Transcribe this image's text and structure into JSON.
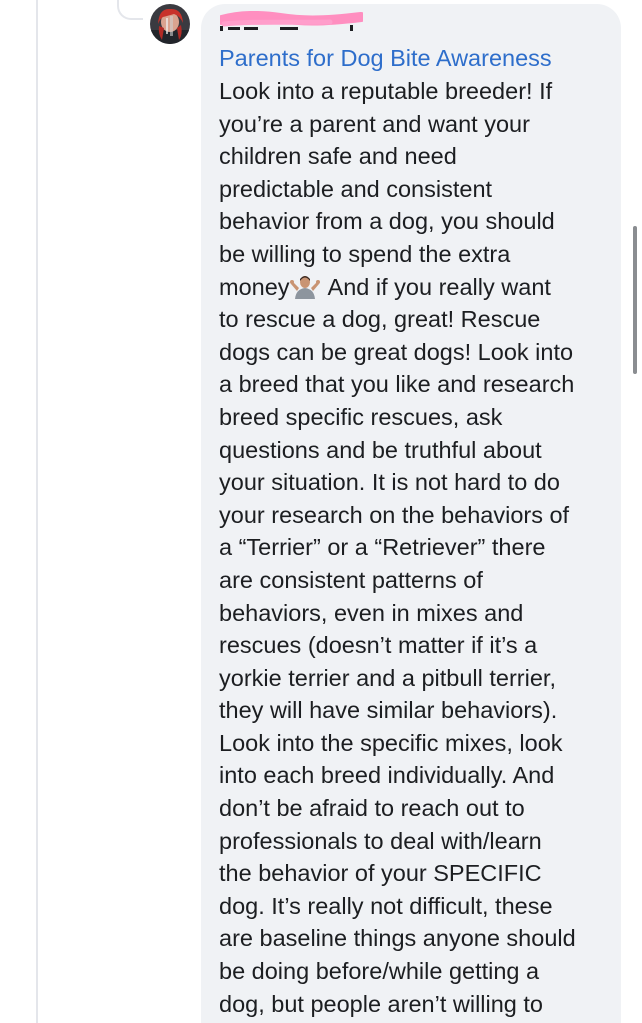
{
  "comment": {
    "group_link": "Parents for Dog Bite Awareness",
    "lines_before_emoji": [
      "Look into a reputable breeder! If",
      "you’re a parent and want your",
      "children safe and need",
      "predictable and consistent",
      "behavior from a dog, you should",
      "be willing to spend the extra"
    ],
    "emoji_line_start": "money",
    "emoji_line_end": "And if you really want",
    "lines_after_emoji": [
      "to rescue a dog, great! Rescue",
      "dogs can be great dogs! Look into",
      "a breed that you like and research",
      "breed specific rescues, ask",
      "questions and be truthful about",
      "your situation. It is not hard to do",
      "your research on the behaviors of",
      "a “Terrier” or a “Retriever” there",
      "are consistent patterns of",
      "behaviors, even in mixes and",
      "rescues (doesn’t matter if it’s a",
      "yorkie terrier and a pitbull terrier,",
      "they will have similar behaviors).",
      "Look into the specific mixes, look",
      "into each breed individually. And",
      "don’t be afraid to reach out to",
      "professionals to deal with/learn",
      "the behavior of your SPECIFIC",
      "dog. It’s really not difficult, these",
      "are baseline things anyone should",
      "be doing before/while getting a",
      "dog, but people aren’t willing to"
    ]
  },
  "icons": {
    "avatar": "avatar-image",
    "emoji": "person-shrugging-emoji",
    "redaction": "pink-redaction-scribble"
  },
  "colors": {
    "bubble": "#f0f2f5",
    "link": "#2e6ecb",
    "text": "#1c1e21",
    "redaction": "#ff8fc0"
  }
}
